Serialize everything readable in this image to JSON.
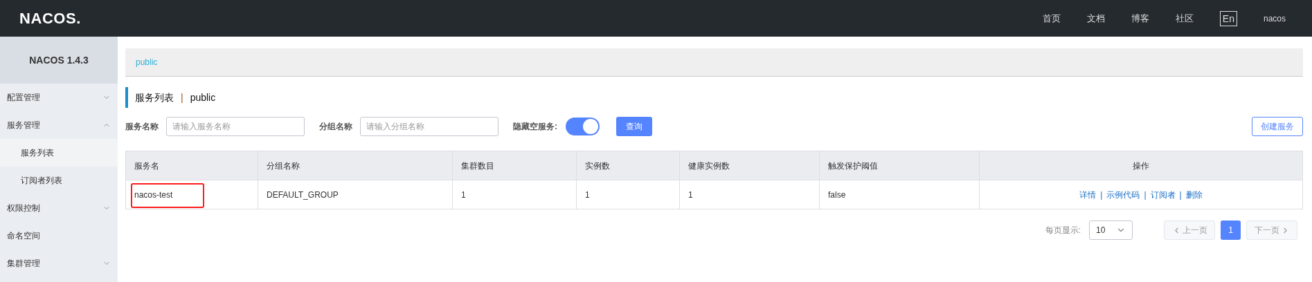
{
  "header": {
    "logo": "NACOS.",
    "nav": [
      "首页",
      "文档",
      "博客",
      "社区"
    ],
    "language": "En",
    "user": "nacos"
  },
  "sidebar": {
    "title": "NACOS 1.4.3",
    "items": [
      {
        "label": "配置管理",
        "expanded": false,
        "has_children": true
      },
      {
        "label": "服务管理",
        "expanded": true,
        "has_children": true,
        "children": [
          {
            "label": "服务列表",
            "selected": true
          },
          {
            "label": "订阅者列表",
            "selected": false
          }
        ]
      },
      {
        "label": "权限控制",
        "expanded": false,
        "has_children": true
      },
      {
        "label": "命名空间",
        "has_children": false
      },
      {
        "label": "集群管理",
        "expanded": false,
        "has_children": true
      }
    ]
  },
  "breadcrumb": "public",
  "page_title": {
    "title": "服务列表",
    "separator": "|",
    "namespace": "public"
  },
  "filters": [
    {
      "label": "服务名称",
      "placeholder": "请输入服务名称"
    },
    {
      "label": "分组名称",
      "placeholder": "请输入分组名称"
    }
  ],
  "hide_empty": {
    "label": "隐藏空服务:",
    "on": true
  },
  "query_button": "查询",
  "create_button": "创建服务",
  "table": {
    "columns": [
      "服务名",
      "分组名称",
      "集群数目",
      "实例数",
      "健康实例数",
      "触发保护阈值",
      "操作"
    ],
    "rows": [
      {
        "cells": [
          "nacos-test",
          "DEFAULT_GROUP",
          "1",
          "1",
          "1",
          "false"
        ],
        "highlighted": true,
        "actions": [
          "详情",
          "示例代码",
          "订阅者",
          "删除"
        ],
        "action_separator": "|"
      }
    ]
  },
  "pagination": {
    "page_size_label": "每页显示:",
    "page_size": "10",
    "prev": "上一页",
    "next": "下一页",
    "pages": [
      {
        "label": "1",
        "selected": true
      }
    ],
    "prev_disabled": true,
    "next_disabled": true
  }
}
